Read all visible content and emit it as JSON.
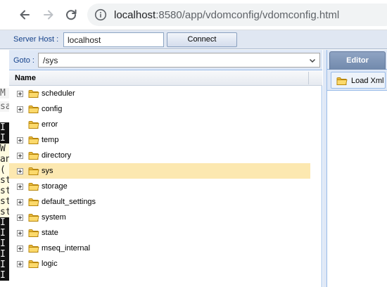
{
  "browser": {
    "url_host": "localhost",
    "url_path": ":8580/app/vdomconfig/vdomconfig.html"
  },
  "server_bar": {
    "label": "Server Host :",
    "host_value": "localhost",
    "connect_label": "Connect"
  },
  "goto": {
    "label": "Goto :",
    "value": "/sys"
  },
  "tree": {
    "column_header": "Name",
    "selected_index": 5,
    "items": [
      {
        "label": "scheduler",
        "expandable": true
      },
      {
        "label": "config",
        "expandable": true
      },
      {
        "label": "error",
        "expandable": false
      },
      {
        "label": "temp",
        "expandable": true
      },
      {
        "label": "directory",
        "expandable": true
      },
      {
        "label": "sys",
        "expandable": true
      },
      {
        "label": "storage",
        "expandable": true
      },
      {
        "label": "default_settings",
        "expandable": true
      },
      {
        "label": "system",
        "expandable": true
      },
      {
        "label": "state",
        "expandable": true
      },
      {
        "label": "mseq_internal",
        "expandable": true
      },
      {
        "label": "logic",
        "expandable": true
      }
    ]
  },
  "editor": {
    "tab_label": "Editor",
    "load_xml_label": "Load Xml"
  },
  "background_text": {
    "lines": [
      {
        "text": "M",
        "style": "plain"
      },
      {
        "text": "sa",
        "style": "plain"
      },
      {
        "text": "I",
        "style": "dark"
      },
      {
        "text": "I",
        "style": "dark"
      },
      {
        "text": " W",
        "style": "light"
      },
      {
        "text": "an",
        "style": "light"
      },
      {
        "text": " (",
        "style": "light"
      },
      {
        "text": "st",
        "style": "light"
      },
      {
        "text": "st",
        "style": "light"
      },
      {
        "text": "st",
        "style": "light"
      },
      {
        "text": "st",
        "style": "light"
      },
      {
        "text": "I",
        "style": "dark"
      },
      {
        "text": "I",
        "style": "dark"
      },
      {
        "text": "I",
        "style": "dark"
      },
      {
        "text": "I",
        "style": "dark"
      },
      {
        "text": "I",
        "style": "dark"
      },
      {
        "text": "I",
        "style": "dark"
      }
    ]
  },
  "colors": {
    "selection": "#fce8b0",
    "panel_header": "#dfe8f6",
    "folder": "#f2c94c"
  },
  "icons": {
    "nav": [
      "back-arrow-icon",
      "forward-arrow-icon",
      "reload-icon",
      "info-icon"
    ],
    "tree": [
      "expand-plus-icon",
      "folder-icon"
    ],
    "editor": [
      "folder-icon"
    ],
    "goto": [
      "chevron-down-icon"
    ]
  }
}
